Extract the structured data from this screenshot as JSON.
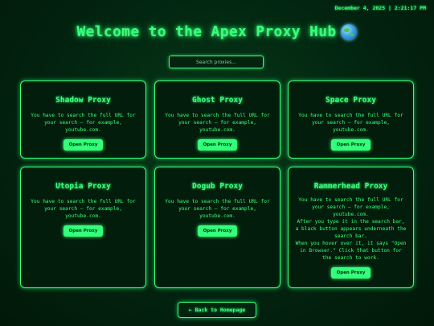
{
  "header": {
    "datetime": "December 4, 2025 | 2:21:17 PM",
    "title": "Welcome to the Apex Proxy Hub",
    "title_icon": "globe-icon"
  },
  "search": {
    "placeholder": "Search proxies...",
    "value": ""
  },
  "cards": [
    {
      "title": "Shadow Proxy",
      "description": "You have to search the full URL for your search — for example, youtube.com.",
      "button_label": "Open Proxy"
    },
    {
      "title": "Ghost Proxy",
      "description": "You have to search the full URL for your search — for example, youtube.com.",
      "button_label": "Open Proxy"
    },
    {
      "title": "Space Proxy",
      "description": "You have to search the full URL for your search — for example, youtube.com.",
      "button_label": "Open Proxy"
    },
    {
      "title": "Utopia Proxy",
      "description": "You have to search the full URL for your search — for example, youtube.com.",
      "button_label": "Open Proxy"
    },
    {
      "title": "Dogub Proxy",
      "description": "You have to search the full URL for your search — for example, youtube.com.",
      "button_label": "Open Proxy"
    },
    {
      "title": "Rammerhead Proxy",
      "description": "You have to search the full URL for your search — for example, youtube.com.",
      "extra_lines": [
        "After you type it in the search bar, a black button appears underneath the search bar.",
        "When you hover over it, it says \"Open in Browser.\" Click that button for the search to work."
      ],
      "button_label": "Open Proxy"
    }
  ],
  "footer": {
    "back_label": "← Back to Homepage"
  },
  "colors": {
    "accent": "#39ff7a",
    "background": "#022410",
    "button_fill": "#33ff7a"
  }
}
